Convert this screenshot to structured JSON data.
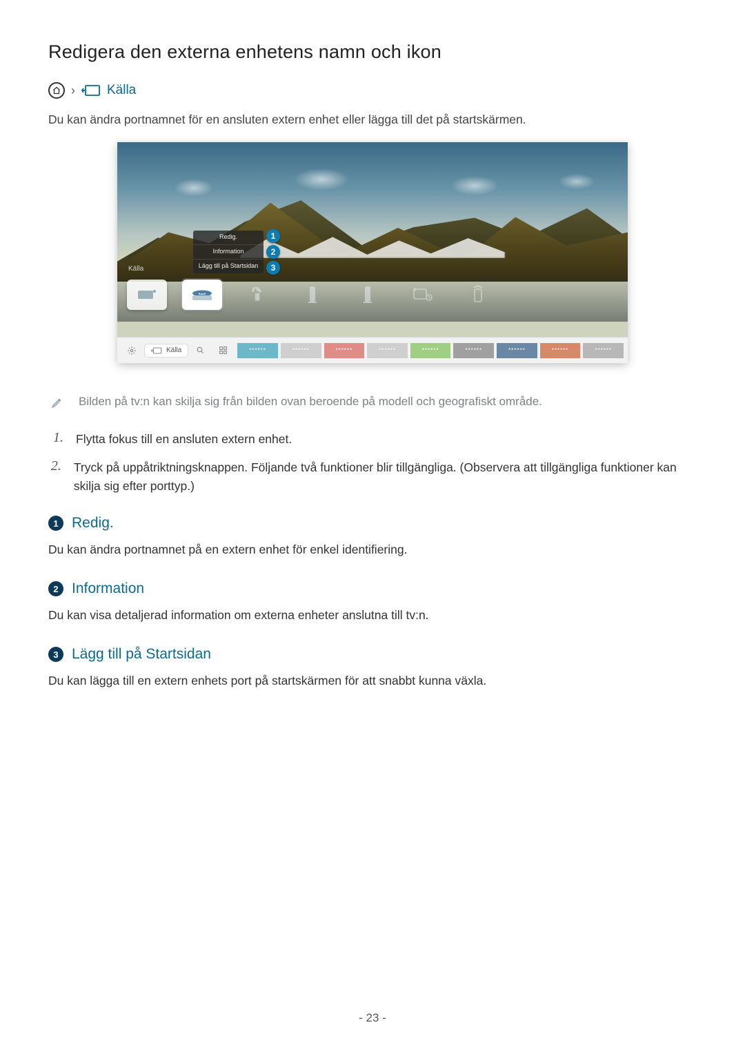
{
  "title": "Redigera den externa enhetens namn och ikon",
  "breadcrumb": {
    "label": "Källa"
  },
  "lead": "Du kan ändra portnamnet för en ansluten extern enhet eller lägga till det på startskärmen.",
  "figure": {
    "source_strip_title": "Källa",
    "menu": {
      "edit": "Redig.",
      "info": "Information",
      "add_home": "Lägg till på Startsidan"
    },
    "callouts": [
      "1",
      "2",
      "3"
    ],
    "bottom": {
      "source_label": "Källa",
      "tile_placeholder": "******",
      "tile_colors": [
        "#6cb8c9",
        "#cfcfcf",
        "#e08d87",
        "#cfcfcf",
        "#9fcf82",
        "#a0a0a0",
        "#6a88a6",
        "#d68a6a",
        "#b8b8b8"
      ]
    }
  },
  "note": "Bilden på tv:n kan skilja sig från bilden ovan beroende på modell och geografiskt område.",
  "steps": [
    "Flytta fokus till en ansluten extern enhet.",
    "Tryck på uppåtriktningsknappen. Följande två funktioner blir tillgängliga. (Observera att tillgängliga funktioner kan skilja sig efter porttyp.)"
  ],
  "sections": [
    {
      "num": "1",
      "heading": "Redig.",
      "body": "Du kan ändra portnamnet på en extern enhet för enkel identifiering."
    },
    {
      "num": "2",
      "heading": "Information",
      "body": "Du kan visa detaljerad information om externa enheter anslutna till tv:n."
    },
    {
      "num": "3",
      "heading": "Lägg till på Startsidan",
      "body": "Du kan lägga till en extern enhets port på startskärmen för att snabbt kunna växla."
    }
  ],
  "page_number": "- 23 -"
}
